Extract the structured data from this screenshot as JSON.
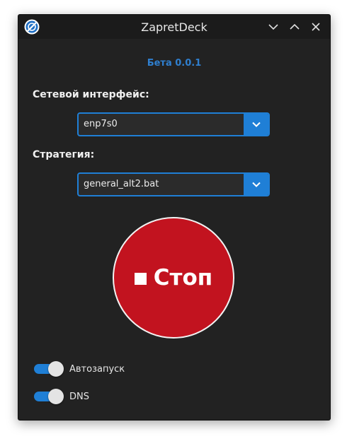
{
  "window": {
    "title": "ZapretDeck"
  },
  "header": {
    "version": "Бета 0.0.1"
  },
  "network_interface": {
    "label": "Сетевой интерфейс:",
    "selected": "enp7s0"
  },
  "strategy": {
    "label": "Стратегия:",
    "selected": "general_alt2.bat"
  },
  "main_button": {
    "label": "Стоп",
    "color": "#c2131f"
  },
  "toggles": [
    {
      "label": "Автозапуск",
      "on": true
    },
    {
      "label": "DNS",
      "on": true
    }
  ],
  "colors": {
    "accent": "#1f7fd6",
    "version_text": "#2f7fcf",
    "background": "#222222"
  },
  "icons": {
    "app": "zapret-logo-icon",
    "minimize": "chevron-down-icon",
    "maximize": "chevron-up-icon",
    "close": "close-icon",
    "dropdown": "chevron-down-icon",
    "stop": "stop-square-icon"
  }
}
